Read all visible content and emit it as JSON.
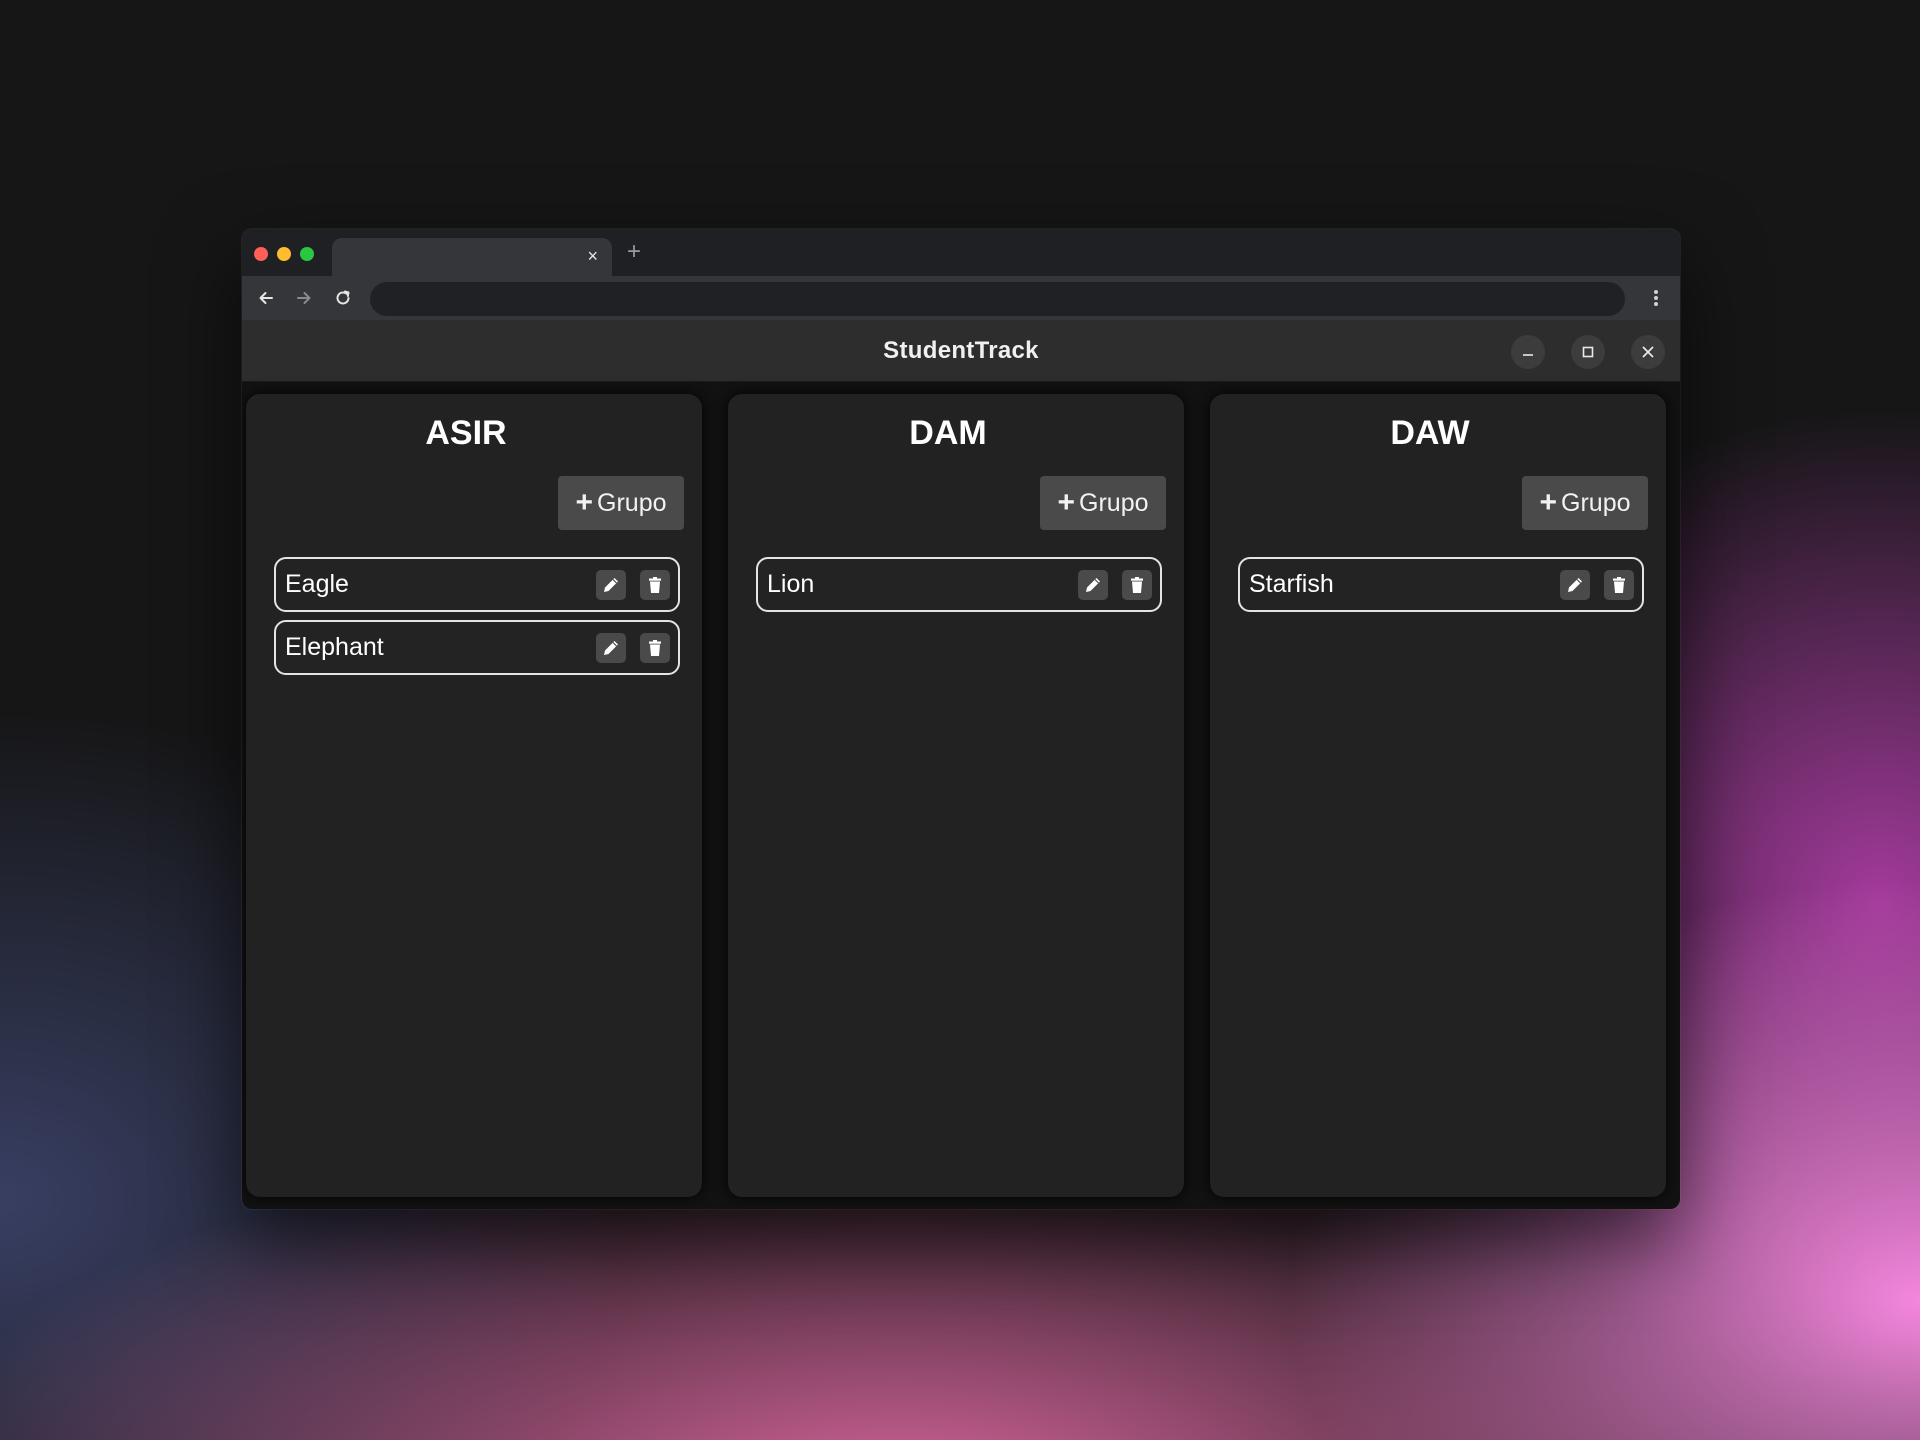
{
  "browser": {
    "tab_close_glyph": "×",
    "new_tab_glyph": "+",
    "address": ""
  },
  "app": {
    "title": "StudentTrack"
  },
  "columns": [
    {
      "title": "ASIR",
      "add_button_label": "Grupo",
      "groups": [
        "Eagle",
        "Elephant"
      ]
    },
    {
      "title": "DAM",
      "add_button_label": "Grupo",
      "groups": [
        "Lion"
      ]
    },
    {
      "title": "DAW",
      "add_button_label": "Grupo",
      "groups": [
        "Starfish"
      ]
    }
  ],
  "colors": {
    "accent_button": "#4a4a4a",
    "panel": "#222222",
    "header": "#2d2d2d"
  },
  "icons": {
    "edit": "pencil-icon",
    "delete": "trash-icon",
    "add": "plus-icon"
  }
}
